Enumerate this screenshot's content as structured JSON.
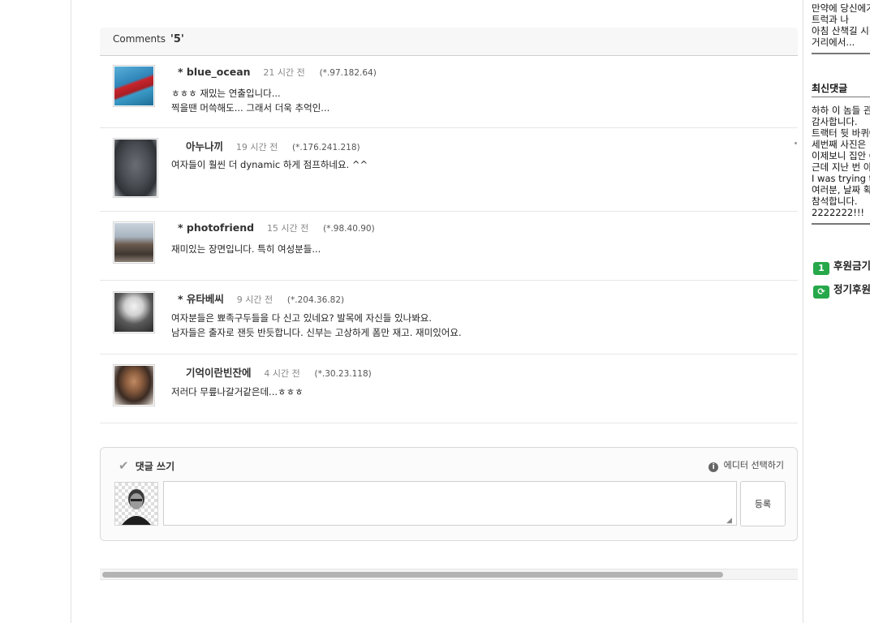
{
  "comments_section": {
    "label": "Comments",
    "count": "'5'"
  },
  "comments": [
    {
      "name": "* blue_ocean",
      "time": "21 시간 전",
      "ip": "(*.97.182.64)",
      "lines": [
        "ㅎㅎㅎ 재밌는 연출입니다...",
        "찍을땐 머쓱해도... 그래서 더욱 추억인..."
      ],
      "avatar": "red-dress-photo-avatar"
    },
    {
      "name": "아누나끼",
      "time": "19 시간 전",
      "ip": "(*.176.241.218)",
      "lines": [
        "여자들이 훨씬 더 dynamic 하게 점프하네요.  ^^"
      ],
      "avatar": "gray-dog-avatar"
    },
    {
      "name": "* photofriend",
      "time": "15 시간 전",
      "ip": "(*.98.40.90)",
      "lines": [
        "재미있는 장면입니다. 특히 여성분들..."
      ],
      "avatar": "eiffel-tower-avatar"
    },
    {
      "name": "* 유타베씨",
      "time": "9 시간 전",
      "ip": "(*.204.36.82)",
      "lines": [
        "여자분들은 뾰족구두들을 다 신고 있네요?  발목에 자신들 있나봐요.",
        "남자들은 출자로 잰듯 반듯합니다. 신부는 고상하게 폼만 재고. 재미있어요."
      ],
      "avatar": "bw-portrait-avatar"
    },
    {
      "name": "기억이란빈잔에",
      "time": "4 시간 전",
      "ip": "(*.30.23.118)",
      "lines": [
        "저러다 무릎나갈거같은데...ㅎㅎㅎ"
      ],
      "avatar": "man-glasses-avatar"
    }
  ],
  "write_box": {
    "title": "댓글 쓰기",
    "editor_select": "에디터 선택하기",
    "submit_label": "등록",
    "textarea_value": ""
  },
  "sidebar": {
    "top_lines": [
      "만약에 당신에기",
      "트럭과 나",
      "아침 산책길 시리",
      "거리에서..."
    ],
    "recent_comments_title": "최신댓글",
    "recent_comments": [
      "하하 이 놈들 관",
      "감사합니다.",
      "트랙터 뒷 바퀴에",
      "세번째 사진은 !",
      "이제보니 집안 C",
      "근데 지난 번 아",
      "I was trying to",
      "여러분, 날짜 확",
      "참석합니다.",
      "2222222!!!"
    ],
    "buttons": [
      {
        "icon": "1",
        "label": "후원금기"
      },
      {
        "icon": "⟳",
        "label": "정기후원"
      }
    ]
  }
}
